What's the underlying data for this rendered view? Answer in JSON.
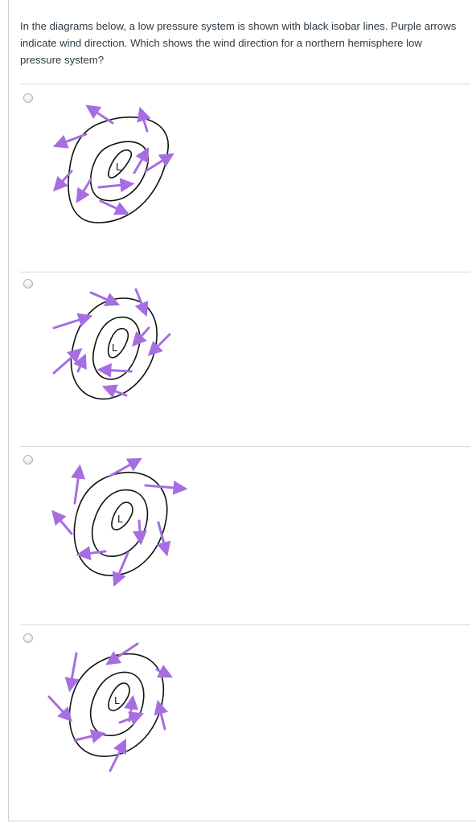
{
  "question": {
    "text": "In the diagrams below, a low pressure system is shown with black isobar lines. Purple arrows indicate wind direction. Which shows the wind direction for a northern hemisphere low pressure system?"
  },
  "options": [
    {
      "center_label": "L",
      "answer_choice": "clockwise-outward"
    },
    {
      "center_label": "L",
      "answer_choice": "counterclockwise-inward"
    },
    {
      "center_label": "L",
      "answer_choice": "mixed"
    },
    {
      "center_label": "L",
      "answer_choice": "inward-clockwise"
    }
  ],
  "colors": {
    "arrow": "#a66ee0",
    "isobar": "#111111",
    "text": "#2d3b45",
    "separator": "#d9d9d9"
  }
}
